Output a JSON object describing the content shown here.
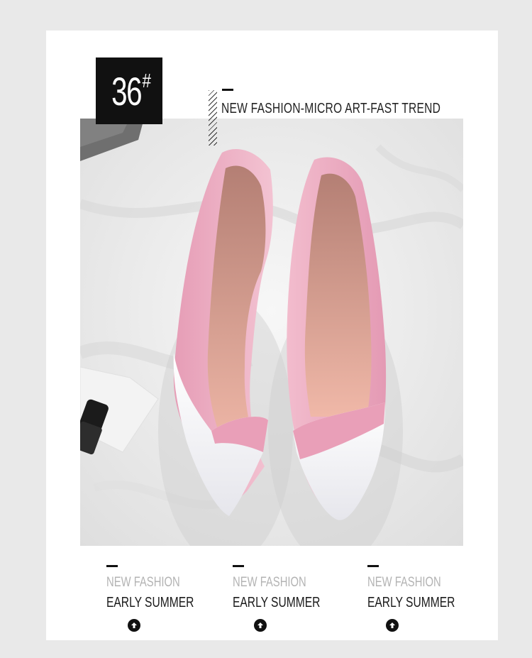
{
  "badge": {
    "number": "36",
    "symbol": "#"
  },
  "headline": "NEW FASHION-MICRO ART-FAST TREND",
  "columns": [
    {
      "line1": "NEW FASHION",
      "line2": "EARLY SUMMER"
    },
    {
      "line1": "NEW FASHION",
      "line2": "EARLY SUMMER"
    },
    {
      "line1": "NEW FASHION",
      "line2": "EARLY SUMMER"
    }
  ],
  "icons": {
    "arrow": "arrow-up-circle-icon"
  },
  "colors": {
    "background": "#e9e9e9",
    "card": "#ffffff",
    "badge": "#111111",
    "shoe_pink": "#e9a8bf",
    "shoe_white": "#f4f4f6"
  }
}
